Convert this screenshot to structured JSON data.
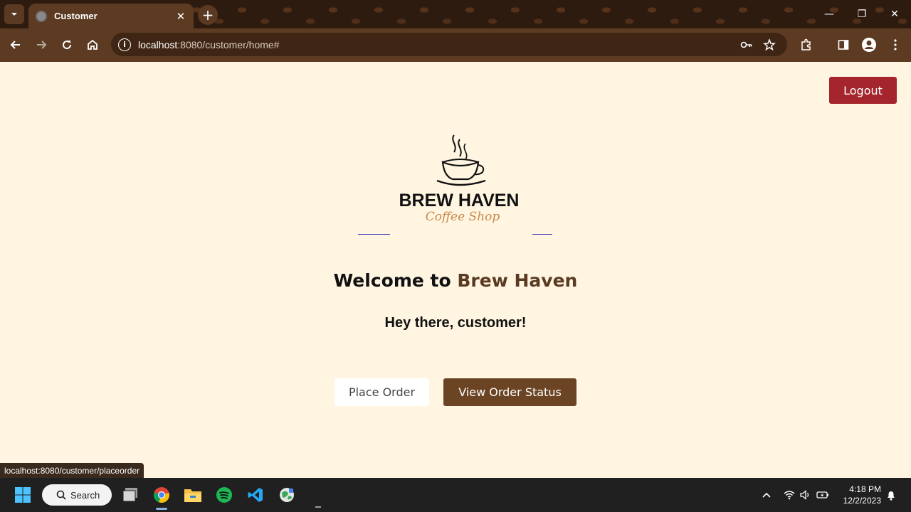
{
  "browser": {
    "tab_title": "Customer",
    "tab_close": "✕",
    "new_tab": "+",
    "url_host": "localhost",
    "url_rest": ":8080/customer/home#",
    "window_min": "—",
    "window_max": "❐",
    "window_close": "✕"
  },
  "page": {
    "logout_label": "Logout",
    "logo": {
      "brand_text": "BREW HAVEN",
      "script_text": "Coffee Shop"
    },
    "welcome_prefix": "Welcome to ",
    "welcome_brand": "Brew Haven",
    "greeting": "Hey there, customer!",
    "place_order_label": "Place Order",
    "view_status_label": "View Order Status",
    "status_url": "localhost:8080/customer/placeorder"
  },
  "colors": {
    "accent_brown": "#6b4423",
    "logout_red": "#a4262c",
    "page_bg": "#fff5e1"
  },
  "taskbar": {
    "search_label": "Search",
    "time": "4:18 PM",
    "date": "12/2/2023",
    "icons": [
      "windows-start-icon",
      "search-icon",
      "task-view-icon",
      "chrome-icon",
      "file-explorer-icon",
      "spotify-icon",
      "vscode-icon",
      "globe-app-icon"
    ]
  }
}
